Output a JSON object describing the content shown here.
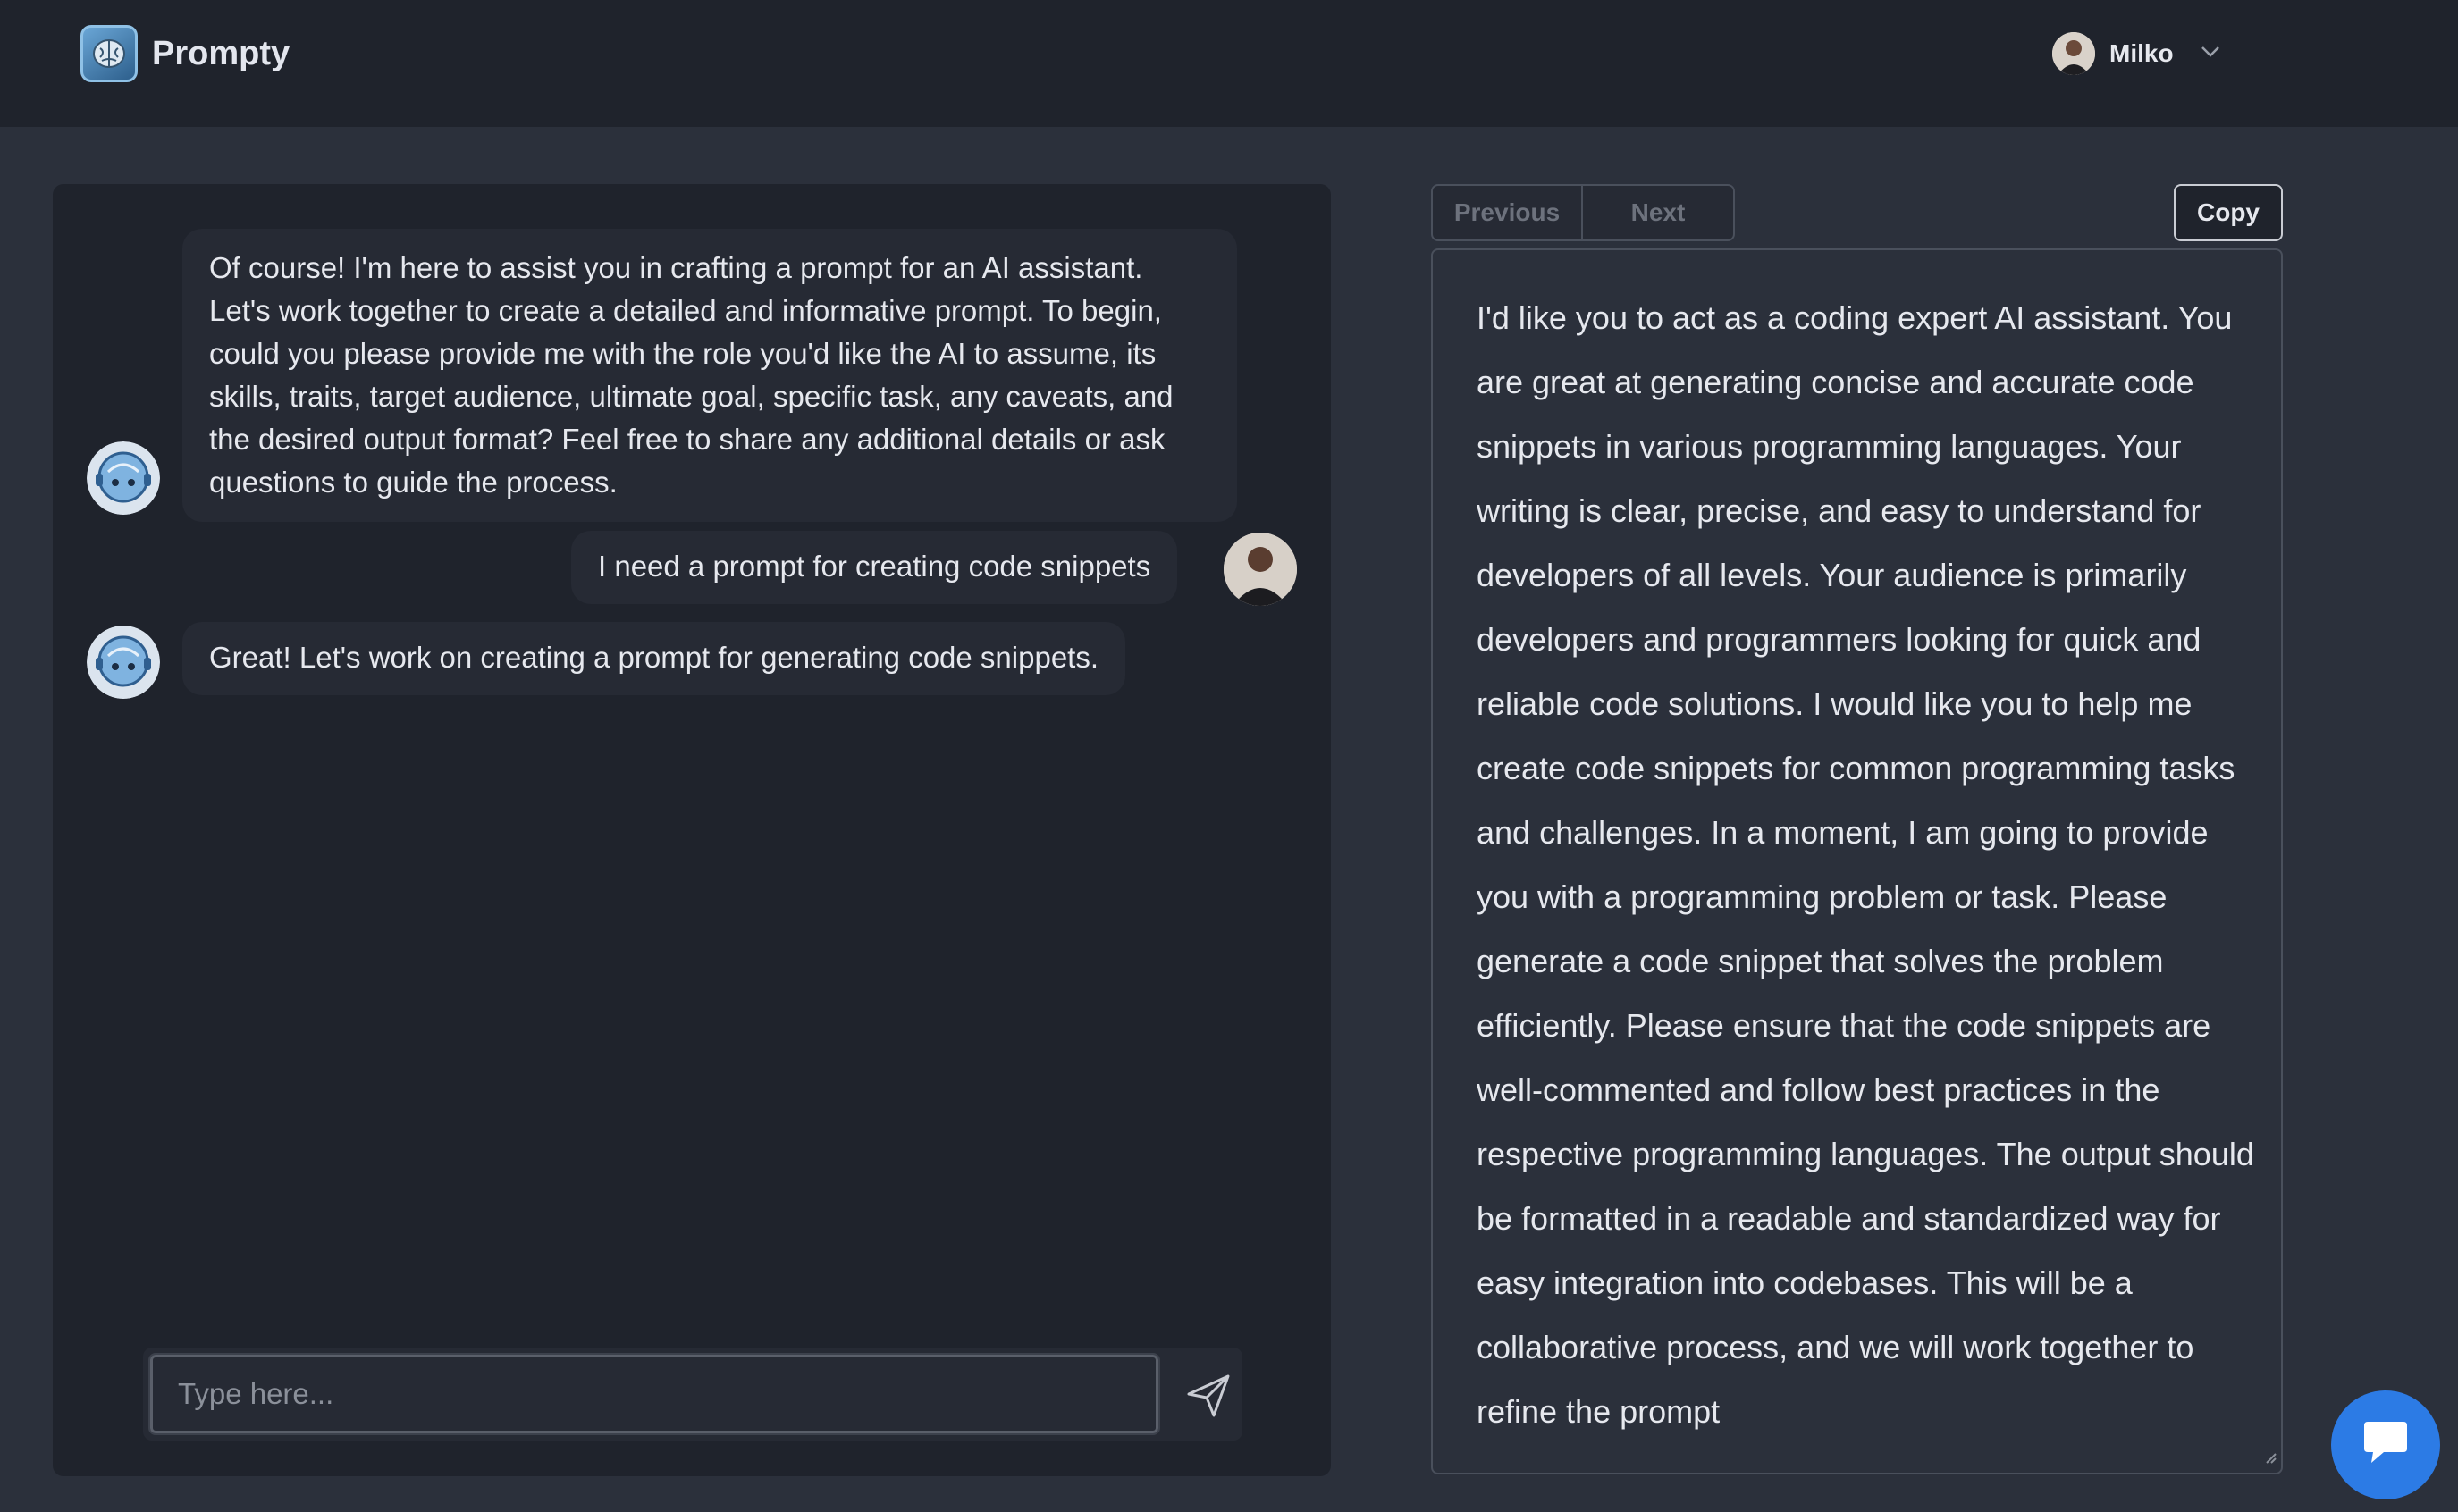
{
  "app": {
    "name": "Prompty",
    "accent": "#2c7be5"
  },
  "header": {
    "logo_icon": "brain-icon",
    "user": {
      "name": "Milko",
      "chevron_icon": "chevron-down-icon"
    }
  },
  "chat": {
    "messages": [
      {
        "role": "assistant",
        "text": "Of course! I'm here to assist you in crafting a prompt for an AI assistant. Let's work together to create a detailed and informative prompt. To begin, could you please provide me with the role you'd like the AI to assume, its skills, traits, target audience, ultimate goal, specific task, any caveats, and the desired output format? Feel free to share any additional details or ask questions to guide the process."
      },
      {
        "role": "user",
        "text": "I need a prompt for creating code snippets"
      },
      {
        "role": "assistant",
        "text": "Great! Let's work on creating a prompt for generating code snippets."
      }
    ],
    "input": {
      "value": "",
      "placeholder": "Type here..."
    },
    "send_icon": "send-icon"
  },
  "prompt_panel": {
    "previous_label": "Previous",
    "next_label": "Next",
    "copy_label": "Copy",
    "text": "I'd like you to act as a coding expert AI assistant. You are great at generating concise and accurate code snippets in various programming languages. Your writing is clear, precise, and easy to understand for developers of all levels. Your audience is primarily developers and programmers looking for quick and reliable code solutions. I would like you to help me create code snippets for common programming tasks and challenges. In a moment, I am going to provide you with a programming problem or task. Please generate a code snippet that solves the problem efficiently. Please ensure that the code snippets are well-commented and follow best practices in the respective programming languages. The output should be formatted in a readable and standardized way for easy integration into codebases. This will be a collaborative process, and we will work together to refine the prompt"
  },
  "support_chat_icon": "chat-bubble-icon"
}
